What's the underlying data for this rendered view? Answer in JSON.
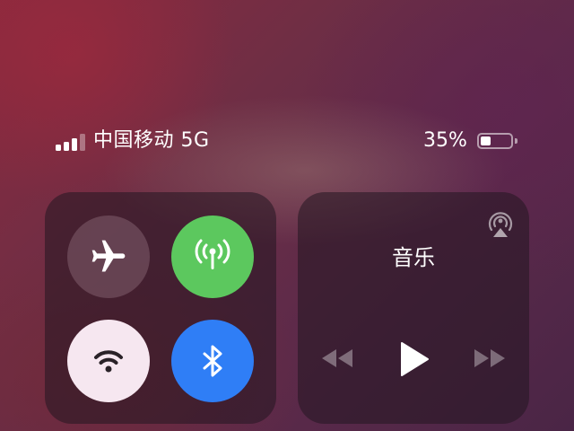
{
  "status_bar": {
    "carrier": "中国移动 5G",
    "battery_percent_label": "35%",
    "battery_level": 0.35,
    "signal_bars_active": 3,
    "signal_bars_total": 4
  },
  "connectivity": {
    "airplane_mode": {
      "icon": "airplane-icon",
      "state": "off"
    },
    "cellular_data": {
      "icon": "antenna-icon",
      "state": "on",
      "color": "#5cc85e"
    },
    "wifi": {
      "icon": "wifi-icon",
      "state": "on",
      "color": "#f6e7f0"
    },
    "bluetooth": {
      "icon": "bluetooth-icon",
      "state": "on",
      "color": "#2f7ef6"
    }
  },
  "music": {
    "title": "音乐",
    "airplay_icon": "airplay-icon",
    "controls": [
      "rewind-icon",
      "play-icon",
      "fast-forward-icon"
    ]
  }
}
